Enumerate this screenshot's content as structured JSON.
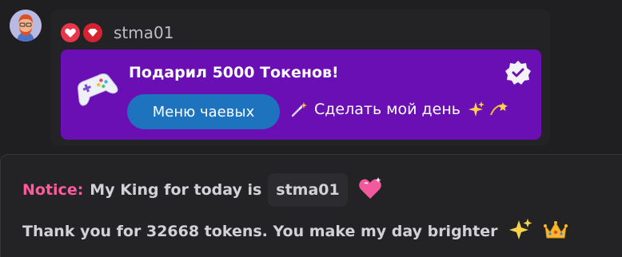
{
  "message": {
    "username": "stma01",
    "badges": [
      "heart-badge-icon",
      "diamond-badge-icon"
    ],
    "tip": {
      "title": "Подарил 5000 Токенов!",
      "menu_button_label": "Меню чаевых",
      "make_day_label": "Сделать мой день",
      "icon": "gamepad-icon",
      "verified_icon": "verified-badge-icon"
    }
  },
  "notice": {
    "label": "Notice:",
    "line1_text": "My King for today is",
    "king_username": "stma01",
    "line2_text": "Thank you for 32668 tokens. You make my day brighter"
  },
  "colors": {
    "background": "#1f1f21",
    "tip_panel": "#6a0fb3",
    "menu_button": "#1e73be",
    "notice_label": "#ff5a9e"
  }
}
